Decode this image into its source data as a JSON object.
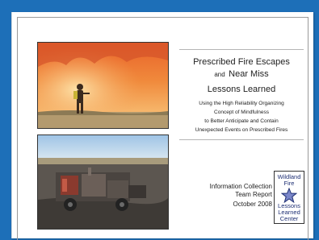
{
  "title": {
    "line1": "Prescribed Fire Escapes",
    "line2_small": "and",
    "line2_large": "Near Miss",
    "line3": "Lessons Learned"
  },
  "subtitle": [
    "Using the High Reliability Organizing",
    "Concept of Mindfulness",
    "to Better Anticipate and Contain",
    "Unexpected Events on Prescribed Fires"
  ],
  "report": {
    "line1": "Information Collection",
    "line2": "Team Report",
    "date": "October 2008"
  },
  "badge": {
    "top": [
      "Wildland",
      "Fire"
    ],
    "bottom": [
      "Lessons",
      "Learned",
      "Center"
    ],
    "icon": "star-icon",
    "color": "#1e2f73"
  },
  "colors": {
    "background": "#1d6fb8",
    "page": "#ffffff"
  }
}
